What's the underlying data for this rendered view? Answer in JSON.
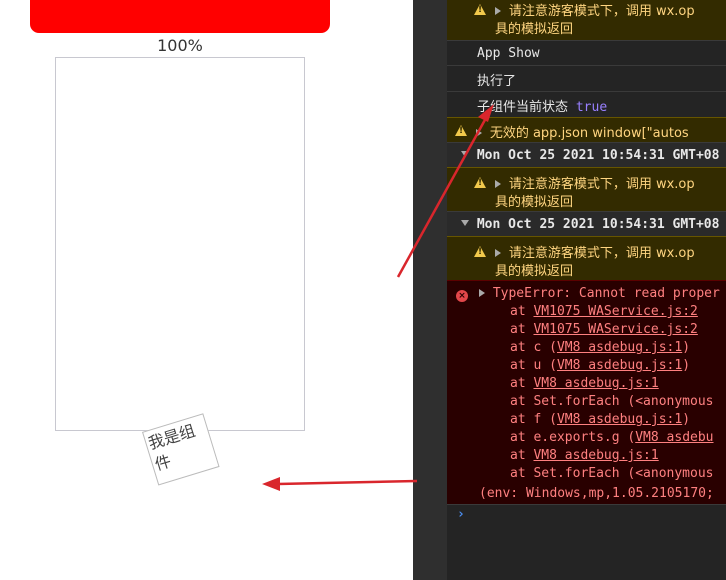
{
  "simulator": {
    "percent_label": "100%",
    "component_label": "我是组件",
    "bar_color": "#ff0000"
  },
  "console": {
    "warn_text_1": "请注意游客模式下，调用 wx.op",
    "warn_text_2": "具的模拟返回",
    "app_show": "App Show",
    "executed": "执行了",
    "child_state_label": "子组件当前状态",
    "child_state_value": "true",
    "invalid_json": "无效的 app.json window[\"autos",
    "group_timestamp": "Mon Oct 25 2021 10:54:31 GMT+08",
    "error_head": "TypeError: Cannot read proper",
    "stack": [
      {
        "prefix": "at ",
        "link": "VM1075 WAService.js:2",
        "suffix": ""
      },
      {
        "prefix": "at ",
        "link": "VM1075 WAService.js:2",
        "suffix": ""
      },
      {
        "prefix": "at c (",
        "link": "VM8 asdebug.js:1",
        "suffix": ")"
      },
      {
        "prefix": "at u (",
        "link": "VM8 asdebug.js:1",
        "suffix": ")"
      },
      {
        "prefix": "at ",
        "link": "VM8 asdebug.js:1",
        "suffix": ""
      },
      {
        "prefix": "at Set.forEach (<anonymous",
        "link": "",
        "suffix": ""
      },
      {
        "prefix": "at f (",
        "link": "VM8 asdebug.js:1",
        "suffix": ")"
      },
      {
        "prefix": "at e.exports.g (",
        "link": "VM8 asdebu",
        "suffix": ""
      },
      {
        "prefix": "at ",
        "link": "VM8 asdebug.js:1",
        "suffix": ""
      },
      {
        "prefix": "at Set.forEach (<anonymous",
        "link": "",
        "suffix": ""
      }
    ],
    "env_line": "(env: Windows,mp,1.05.2105170;",
    "prompt_symbol": "›"
  },
  "colors": {
    "arrow": "#d9262c",
    "console_bg": "#242424",
    "warn_bg": "#332b00",
    "error_bg": "#290000"
  }
}
